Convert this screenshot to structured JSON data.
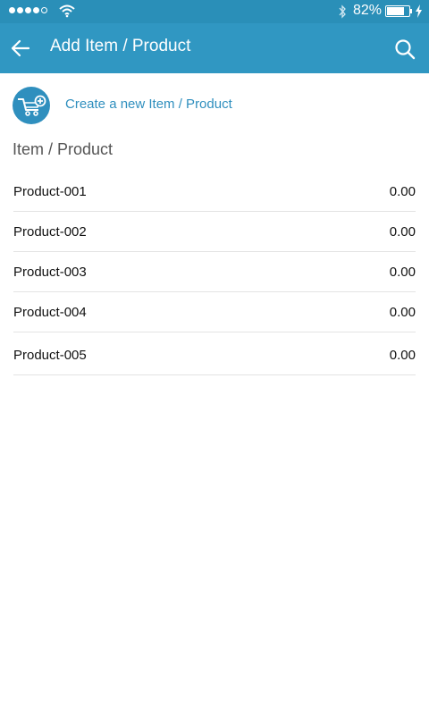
{
  "status_bar": {
    "battery_percent": "82%",
    "battery_level": 0.82,
    "signal_bars_filled": 4,
    "signal_bars_total": 5
  },
  "app_bar": {
    "title": "Add Item / Product",
    "back_icon": "arrow-left-icon",
    "search_icon": "search-icon",
    "color": "#3097c2"
  },
  "create_action": {
    "label": "Create a new Item / Product",
    "icon": "cart-add-icon",
    "color": "#2f8fbe"
  },
  "section": {
    "title": "Item / Product"
  },
  "items": [
    {
      "name": "Product-001",
      "value": "0.00"
    },
    {
      "name": "Product-002",
      "value": "0.00"
    },
    {
      "name": "Product-003",
      "value": "0.00"
    },
    {
      "name": "Product-004",
      "value": "0.00"
    },
    {
      "name": "Product-005",
      "value": "0.00"
    }
  ]
}
